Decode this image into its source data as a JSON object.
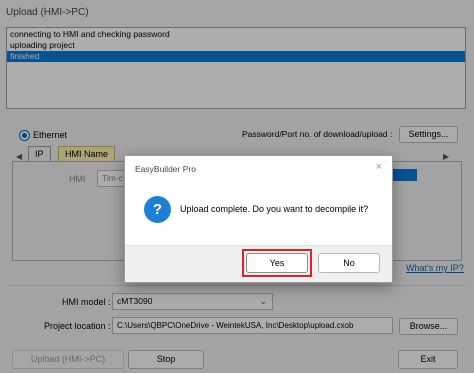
{
  "window": {
    "title": "Upload (HMI->PC)"
  },
  "log": {
    "lines": [
      "connecting to HMI and checking password",
      "uploading project",
      "finished"
    ]
  },
  "connection": {
    "ethernet_label": "Ethernet",
    "password_label": "Password/Port no. of download/upload :",
    "settings_button": "Settings..."
  },
  "tabs": {
    "ip": "IP",
    "hmi_name": "HMI Name"
  },
  "panel": {
    "hmi_label": "HMI",
    "hmi_value": "Tim-c"
  },
  "whats_my_ip": "What's my IP?",
  "form": {
    "hmi_model_label": "HMI model :",
    "hmi_model_value": "cMT3090",
    "project_location_label": "Project location :",
    "project_location_value": "C:\\Users\\QBPC\\OneDrive - WeintekUSA, Inc\\Desktop\\upload.cxob",
    "browse_button": "Browse..."
  },
  "bottom": {
    "upload_button": "Upload (HMI->PC)",
    "stop_button": "Stop",
    "exit_button": "Exit"
  },
  "dialog": {
    "title": "EasyBuilder Pro",
    "message": "Upload complete. Do you want to decompile it?",
    "yes_button": "Yes",
    "no_button": "No",
    "highlight_color": "#d9252a"
  }
}
